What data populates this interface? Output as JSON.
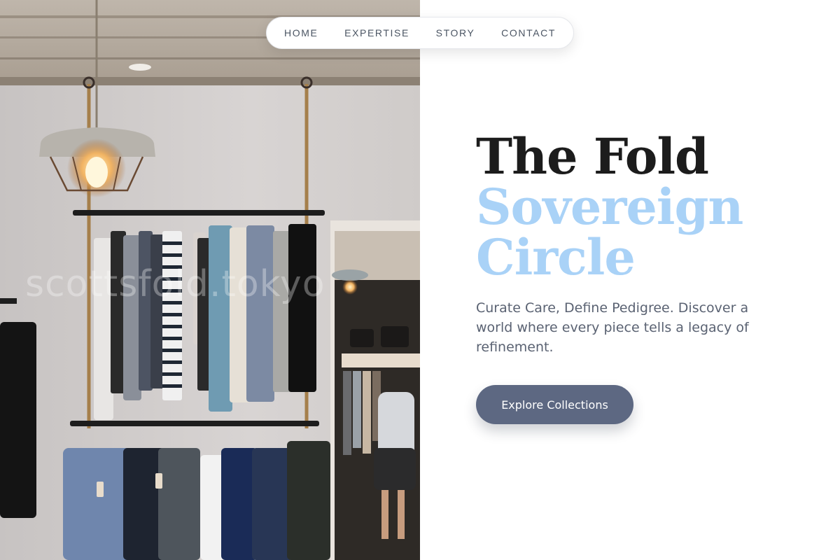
{
  "nav": {
    "items": [
      {
        "label": "HOME"
      },
      {
        "label": "EXPERTISE"
      },
      {
        "label": "STORY"
      },
      {
        "label": "CONTACT"
      }
    ]
  },
  "hero": {
    "title_line1": "The Fold",
    "title_line2": "Sovereign",
    "title_line3": "Circle",
    "description": "Curate Care, Define Pedigree. Discover a world where every piece tells a legacy of refinement.",
    "cta_label": "Explore Collections"
  },
  "photo": {
    "watermark": "scottsfold.tokyo"
  },
  "colors": {
    "title_dark": "#1c1c1c",
    "title_accent": "#a9d2f7",
    "body_text": "#5a6272",
    "button_bg": "#5d6882",
    "nav_text": "#4b5563"
  }
}
